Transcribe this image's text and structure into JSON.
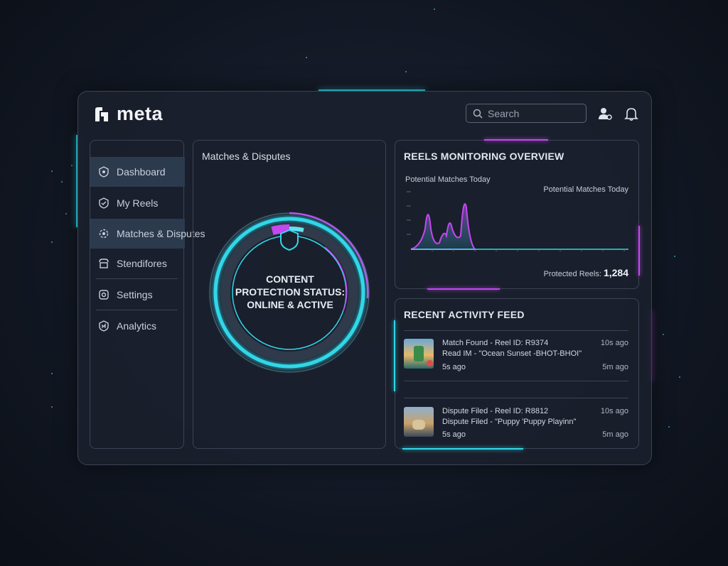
{
  "app": {
    "logo_text": "meta"
  },
  "header": {
    "search_placeholder": "Search",
    "icons": [
      "user-settings-icon",
      "bell-icon"
    ]
  },
  "sidebar": {
    "items": [
      {
        "label": "Dashboard",
        "icon": "shield-icon",
        "active": true
      },
      {
        "label": "My Reels",
        "icon": "reels-check-icon",
        "active": false
      },
      {
        "label": "Matches & Disputes",
        "icon": "dispute-icon",
        "active": true
      },
      {
        "label": "Stendifores",
        "icon": "storefront-icon",
        "active": false
      },
      {
        "label": "Settings",
        "icon": "gear-icon",
        "active": false
      },
      {
        "label": "Analytics",
        "icon": "analytics-icon",
        "active": false
      }
    ]
  },
  "matches_panel": {
    "title": "Matches & Disputes",
    "status_lines": [
      "CONTENT",
      "PROTECTION STATUS:",
      "ONLINE & ACTIVE"
    ]
  },
  "monitoring": {
    "title": "REELS MONITORING OVERVIEW",
    "chart_title": "Potential Matches Today",
    "legend_label": "Potential Matches Today",
    "protected_label": "Protected Reels:",
    "protected_value": "1,284",
    "accent_cyan": "#31d7e8",
    "accent_magenta": "#c447f0"
  },
  "activity": {
    "title": "RECENT ACTIVITY FEED",
    "items": [
      {
        "line1": "Match Found - Reel ID: R9374",
        "line2": "Read IM - \"Ocean Sunset -BHOT-BHOI\"",
        "line3": "5s ago",
        "time1": "10s ago",
        "time3": "5m ago"
      },
      {
        "line1": "Dispute Filed - Reel ID: R8812",
        "line2": "Dispute Filed - \"Puppy 'Puppy Playinn\"",
        "line3": "5s ago",
        "time1": "10s ago",
        "time3": "5m ago"
      }
    ]
  }
}
